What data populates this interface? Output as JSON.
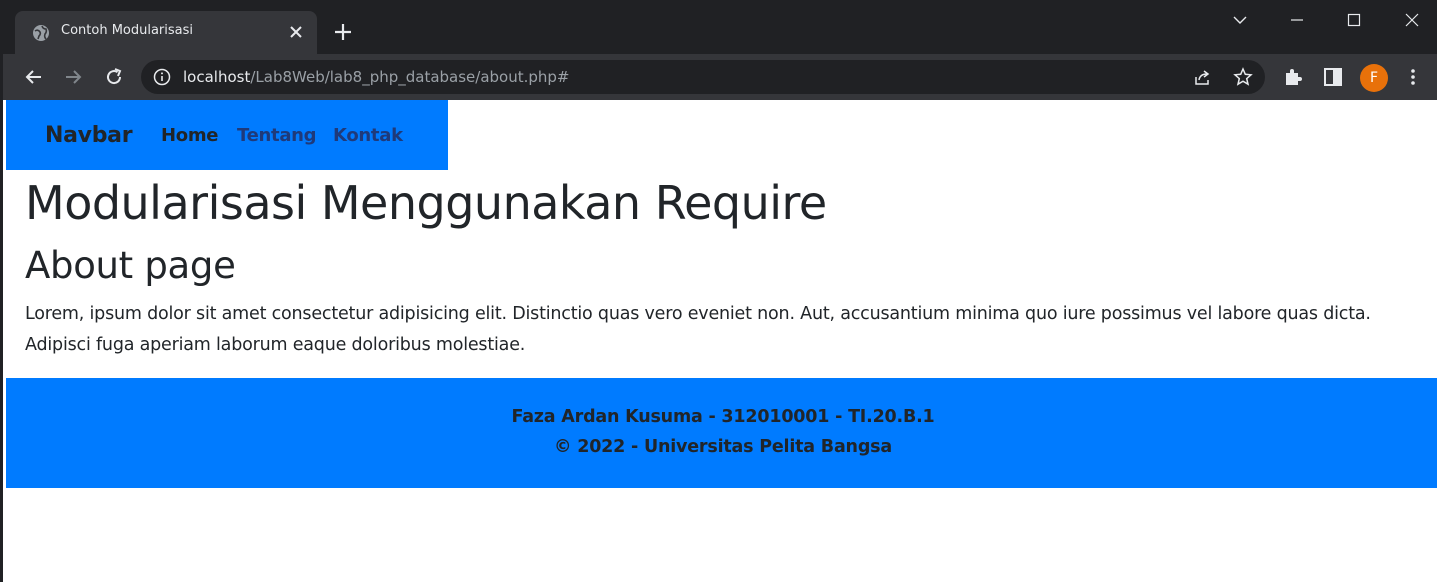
{
  "browser": {
    "tab_title": "Contoh Modularisasi",
    "url_host": "localhost",
    "url_path": "/Lab8Web/lab8_php_database/about.php#",
    "profile_initial": "F",
    "colors": {
      "frame": "#202124",
      "toolbar": "#35363a",
      "profile": "#e8710a"
    }
  },
  "navbar": {
    "brand": "Navbar",
    "links": [
      "Home",
      "Tentang",
      "Kontak"
    ],
    "background": "#007bff"
  },
  "content": {
    "heading": "Modularisasi Menggunakan Require",
    "subheading": "About page",
    "paragraph": "Lorem, ipsum dolor sit amet consectetur adipisicing elit. Distinctio quas vero eveniet non. Aut, accusantium minima quo iure possimus vel labore quas dicta. Adipisci fuga aperiam laborum eaque doloribus molestiae."
  },
  "footer": {
    "line1": "Faza Ardan Kusuma - 312010001 - TI.20.B.1",
    "line2": "© 2022 - Universitas Pelita Bangsa",
    "background": "#007bff"
  }
}
